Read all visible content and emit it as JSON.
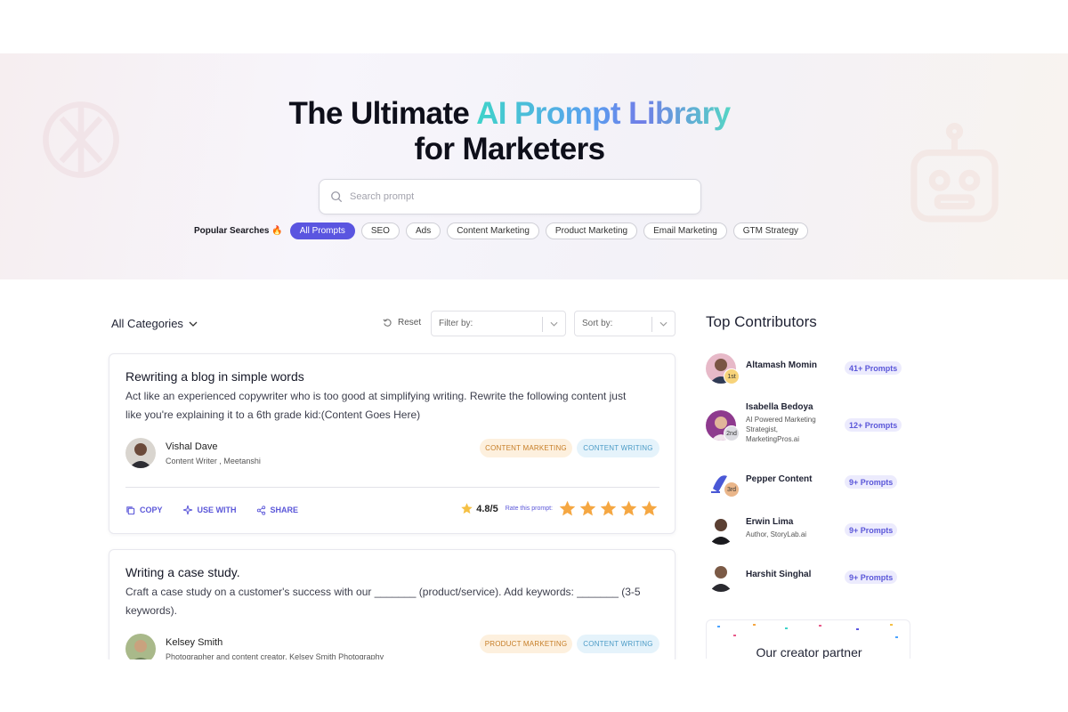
{
  "hero": {
    "title_part1": "The Ultimate ",
    "title_highlight": "AI Prompt Library",
    "title_part2": "for Marketers"
  },
  "search": {
    "placeholder": "Search prompt"
  },
  "popular": {
    "label": "Popular Searches 🔥",
    "chips": [
      {
        "label": "All Prompts",
        "active": true
      },
      {
        "label": "SEO"
      },
      {
        "label": "Ads"
      },
      {
        "label": "Content Marketing"
      },
      {
        "label": "Product Marketing"
      },
      {
        "label": "Email Marketing"
      },
      {
        "label": "GTM Strategy"
      }
    ]
  },
  "toolbar": {
    "categories": "All Categories",
    "reset": "Reset",
    "filter_placeholder": "Filter by:",
    "sort_placeholder": "Sort by:"
  },
  "cards": [
    {
      "title": "Rewriting a blog in simple words",
      "text": "Act like an experienced copywriter who is too good at simplifying writing. Rewrite the following content just like you're explaining it to a 6th grade kid:(Content Goes Here)",
      "author": "Vishal Dave",
      "role": "Content Writer , Meetanshi",
      "tags": [
        "CONTENT MARKETING",
        "CONTENT WRITING"
      ],
      "actions": {
        "copy": "COPY",
        "use": "USE WITH",
        "share": "SHARE"
      },
      "rating": "4.8/5",
      "rate_label": "Rate this prompt:",
      "stars": 5
    },
    {
      "title": "Writing a case study.",
      "text": "Craft a case study on a customer's success with our _______ (product/service). Add keywords: _______ (3-5 keywords).",
      "author": "Kelsey Smith",
      "role": "Photographer and content creator, Kelsey Smith Photography",
      "tags": [
        "PRODUCT MARKETING",
        "CONTENT WRITING"
      ]
    }
  ],
  "contributors": {
    "title": "Top Contributors",
    "items": [
      {
        "name": "Altamash Momin",
        "role": "",
        "rank": "1st",
        "prompts": "41+ Prompts"
      },
      {
        "name": "Isabella Bedoya",
        "role_lines": [
          "AI Powered Marketing",
          "Strategist,",
          "MarketingPros.ai"
        ],
        "rank": "2nd",
        "prompts": "12+ Prompts"
      },
      {
        "name": "Pepper Content",
        "role": "",
        "rank": "3rd",
        "prompts": "9+ Prompts"
      },
      {
        "name": "Erwin Lima",
        "role": "Author, StoryLab.ai",
        "prompts": "9+ Prompts"
      },
      {
        "name": "Harshit Singhal",
        "role": "",
        "prompts": "9+ Prompts"
      }
    ]
  },
  "partner": {
    "title": "Our creator partner"
  },
  "colors": {
    "accent": "#5a55e0",
    "star": "#f5a742"
  }
}
